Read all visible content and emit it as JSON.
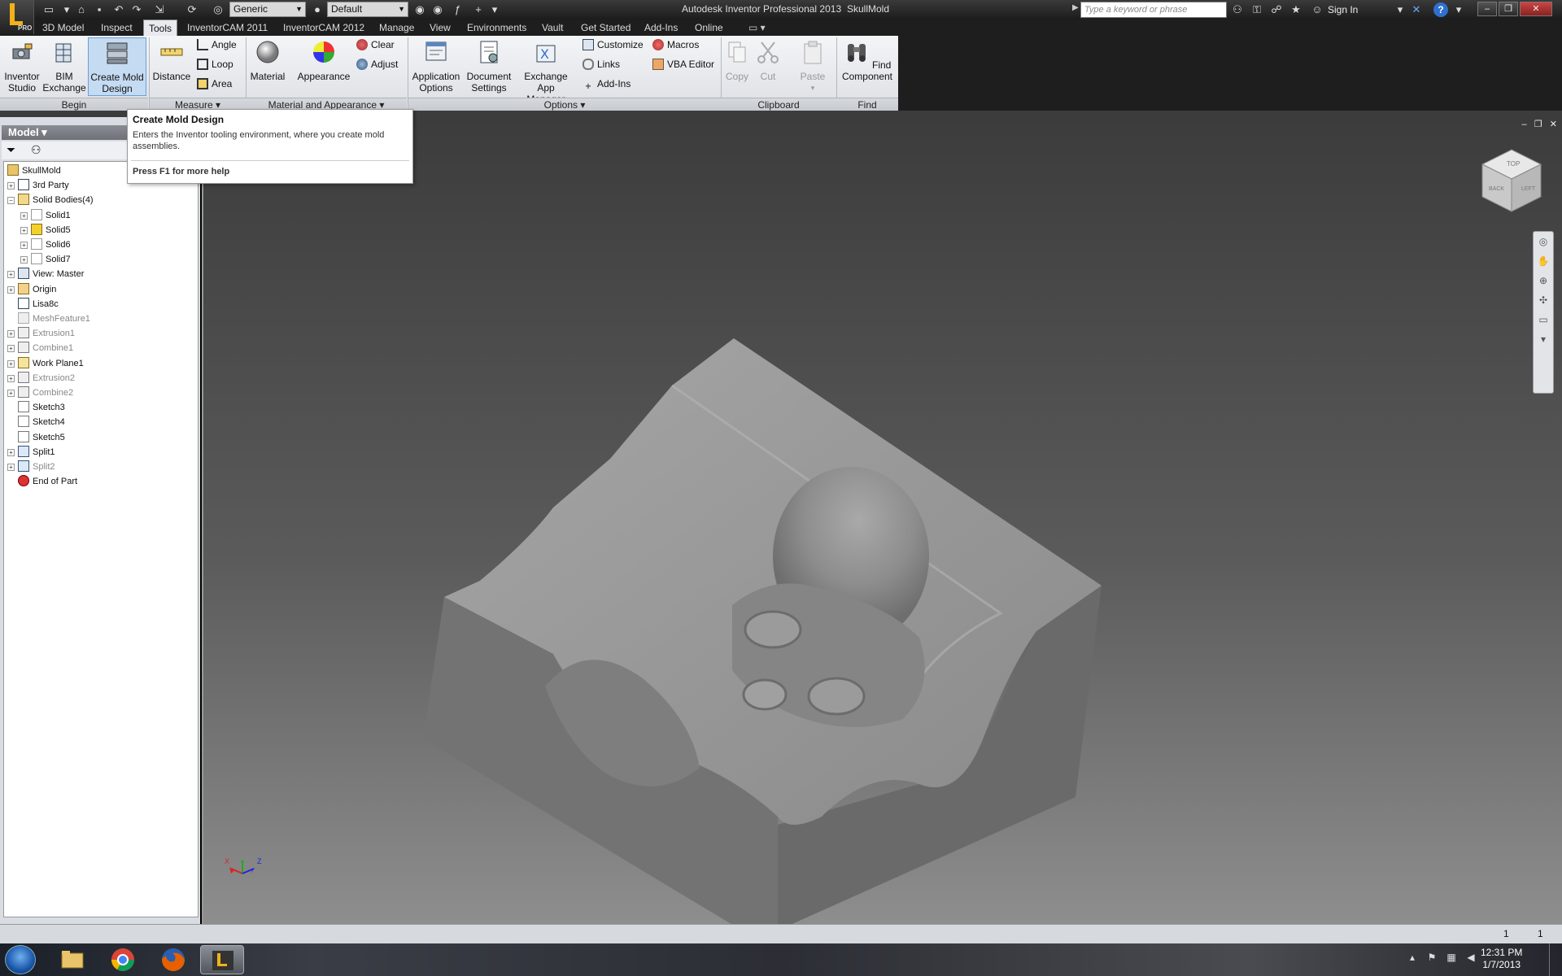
{
  "window": {
    "app_title": "Autodesk Inventor Professional 2013",
    "document_title": "SkullMold",
    "logo_badge": "PRO"
  },
  "qat": {
    "material_combo": "Generic",
    "appearance_combo": "Default"
  },
  "infocenter": {
    "search_placeholder": "Type a keyword or phrase",
    "sign_in": "Sign In",
    "help": "?"
  },
  "ribbon_tabs": [
    {
      "label": "3D Model"
    },
    {
      "label": "Inspect"
    },
    {
      "label": "Tools",
      "active": true
    },
    {
      "label": "InventorCAM 2011"
    },
    {
      "label": "InventorCAM 2012"
    },
    {
      "label": "Manage"
    },
    {
      "label": "View"
    },
    {
      "label": "Environments"
    },
    {
      "label": "Vault"
    },
    {
      "label": "Get Started"
    },
    {
      "label": "Add-Ins"
    },
    {
      "label": "Online"
    }
  ],
  "ribbon": {
    "begin": {
      "panel_label": "Begin",
      "inventor_studio": "Inventor Studio",
      "bim_exchange": "BIM Exchange",
      "create_mold_design": "Create Mold Design"
    },
    "measure": {
      "panel_label": "Measure",
      "distance": "Distance",
      "angle": "Angle",
      "loop": "Loop",
      "area": "Area"
    },
    "material": {
      "panel_label": "Material and Appearance",
      "material": "Material",
      "appearance": "Appearance",
      "clear": "Clear",
      "adjust": "Adjust"
    },
    "options": {
      "panel_label": "Options",
      "application_options": "Application Options",
      "document_settings": "Document Settings",
      "exchange_app_manager": "Exchange App Manager",
      "customize": "Customize",
      "links": "Links",
      "add_ins": "Add-Ins",
      "macros": "Macros",
      "vba_editor": "VBA Editor"
    },
    "clipboard": {
      "panel_label": "Clipboard",
      "copy": "Copy",
      "cut": "Cut",
      "paste": "Paste"
    },
    "find": {
      "panel_label": "Find",
      "find_component": "Find Component"
    }
  },
  "tooltip": {
    "title": "Create Mold Design",
    "body": "Enters the Inventor tooling environment, where you create mold assemblies.",
    "help": "Press F1 for more help"
  },
  "browser": {
    "header": "Model",
    "tree": [
      {
        "label": "SkullMold",
        "level": 0,
        "icon": "part-icon"
      },
      {
        "label": "3rd Party",
        "level": 1,
        "icon": "third-party-icon",
        "expander": "+"
      },
      {
        "label": "Solid Bodies(4)",
        "level": 1,
        "icon": "solid-bodies-icon",
        "expander": "-"
      },
      {
        "label": "Solid1",
        "level": 2,
        "icon": "solid-body-icon",
        "expander": "+"
      },
      {
        "label": "Solid5",
        "level": 2,
        "icon": "solid-body-visible-icon",
        "expander": "+"
      },
      {
        "label": "Solid6",
        "level": 2,
        "icon": "solid-body-icon",
        "expander": "+"
      },
      {
        "label": "Solid7",
        "level": 2,
        "icon": "solid-body-icon",
        "expander": "+"
      },
      {
        "label": "View: Master",
        "level": 1,
        "icon": "view-icon",
        "expander": "+"
      },
      {
        "label": "Origin",
        "level": 1,
        "icon": "folder-icon",
        "expander": "+"
      },
      {
        "label": "Lisa8c",
        "level": 1,
        "icon": "mesh-icon"
      },
      {
        "label": "MeshFeature1",
        "level": 1,
        "icon": "mesh-feature-icon",
        "dim": true
      },
      {
        "label": "Extrusion1",
        "level": 1,
        "icon": "extrusion-icon",
        "expander": "+",
        "dim": true
      },
      {
        "label": "Combine1",
        "level": 1,
        "icon": "combine-icon",
        "expander": "+",
        "dim": true
      },
      {
        "label": "Work Plane1",
        "level": 1,
        "icon": "work-plane-icon",
        "expander": "+"
      },
      {
        "label": "Extrusion2",
        "level": 1,
        "icon": "extrusion-icon",
        "expander": "+",
        "dim": true
      },
      {
        "label": "Combine2",
        "level": 1,
        "icon": "combine-icon",
        "expander": "+",
        "dim": true
      },
      {
        "label": "Sketch3",
        "level": 1,
        "icon": "sketch-icon"
      },
      {
        "label": "Sketch4",
        "level": 1,
        "icon": "sketch-icon"
      },
      {
        "label": "Sketch5",
        "level": 1,
        "icon": "sketch-icon"
      },
      {
        "label": "Split1",
        "level": 1,
        "icon": "split-icon",
        "expander": "+"
      },
      {
        "label": "Split2",
        "level": 1,
        "icon": "split-icon",
        "expander": "+",
        "dim": true
      },
      {
        "label": "End of Part",
        "level": 1,
        "icon": "end-of-part-icon"
      }
    ]
  },
  "viewcube": {
    "faces": [
      "TOP",
      "BACK",
      "LEFT"
    ]
  },
  "statusbar": {
    "left_count": "1",
    "right_count": "1"
  },
  "taskbar": {
    "time": "12:31 PM",
    "date": "1/7/2013"
  },
  "colors": {
    "ribbon_highlight": "#c5dbf2",
    "model_face": "#8f8f8f",
    "tray_bg": "#1e1e1e"
  }
}
